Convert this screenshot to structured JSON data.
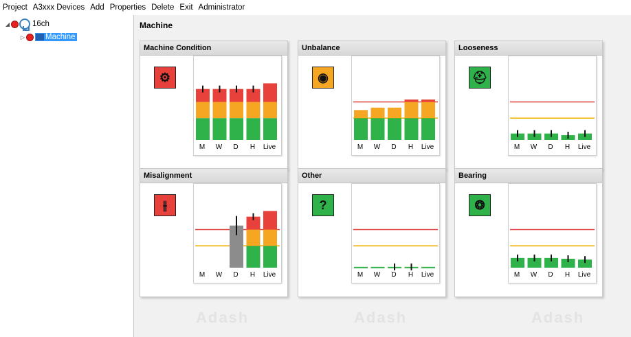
{
  "menu": [
    "Project",
    "A3xxx Devices",
    "Add",
    "Properties",
    "Delete",
    "Exit",
    "Administrator"
  ],
  "tree": {
    "root_label": "16ch",
    "child_label": "Machine"
  },
  "main": {
    "title": "Machine",
    "watermark": "Adash"
  },
  "colors": {
    "green": "#2fb24a",
    "orange": "#f5a623",
    "red": "#e8403a",
    "grey": "#8c8c8c",
    "red_line": "#e03c3c",
    "orange_line": "#f0b000"
  },
  "cards": [
    {
      "title": "Machine Condition",
      "icon": "machine-icon",
      "icon_glyph": "⚙",
      "icon_bg": "#e8403a",
      "x_labels": [
        "M",
        "W",
        "D",
        "H",
        "Live"
      ],
      "bars": [
        {
          "level": 0.63,
          "color": "traffic",
          "error": true
        },
        {
          "level": 0.63,
          "color": "traffic",
          "error": true
        },
        {
          "level": 0.63,
          "color": "traffic",
          "error": true
        },
        {
          "level": 0.63,
          "color": "traffic",
          "error": true
        },
        {
          "level": 0.7,
          "color": "traffic",
          "error": false
        }
      ],
      "show_threshold_lines": false
    },
    {
      "title": "Unbalance",
      "icon": "unbalance-icon",
      "icon_glyph": "◉",
      "icon_bg": "#f5a623",
      "x_labels": [
        "M",
        "W",
        "D",
        "H",
        "Live"
      ],
      "bars": [
        {
          "level": 0.37,
          "color": "traffic",
          "error": false
        },
        {
          "level": 0.4,
          "color": "traffic",
          "error": false
        },
        {
          "level": 0.4,
          "color": "traffic",
          "error": false
        },
        {
          "level": 0.5,
          "color": "traffic",
          "error": false
        },
        {
          "level": 0.5,
          "color": "traffic",
          "error": false
        }
      ],
      "show_threshold_lines": true
    },
    {
      "title": "Looseness",
      "icon": "looseness-icon",
      "icon_glyph": "⛑",
      "icon_bg": "#2fb24a",
      "x_labels": [
        "M",
        "W",
        "D",
        "H",
        "Live"
      ],
      "bars": [
        {
          "level": 0.08,
          "color": "traffic",
          "error": true
        },
        {
          "level": 0.08,
          "color": "traffic",
          "error": true
        },
        {
          "level": 0.08,
          "color": "traffic",
          "error": true
        },
        {
          "level": 0.06,
          "color": "traffic",
          "error": true
        },
        {
          "level": 0.08,
          "color": "traffic",
          "error": true
        }
      ],
      "show_threshold_lines": true
    },
    {
      "title": "Misalignment",
      "icon": "misalignment-icon",
      "icon_glyph": "⫲",
      "icon_bg": "#e8403a",
      "x_labels": [
        "M",
        "W",
        "D",
        "H",
        "Live"
      ],
      "bars": [
        {
          "level": 0.0,
          "color": "traffic",
          "error": false
        },
        {
          "level": 0.0,
          "color": "traffic",
          "error": false
        },
        {
          "level": 0.52,
          "color": "grey",
          "error": true
        },
        {
          "level": 0.63,
          "color": "traffic",
          "error": true
        },
        {
          "level": 0.7,
          "color": "traffic",
          "error": false
        }
      ],
      "show_threshold_lines": true
    },
    {
      "title": "Other",
      "icon": "question-icon",
      "icon_glyph": "?",
      "icon_bg": "#2fb24a",
      "x_labels": [
        "M",
        "W",
        "D",
        "H",
        "Live"
      ],
      "bars": [
        {
          "level": 0.01,
          "color": "traffic",
          "error": false
        },
        {
          "level": 0.01,
          "color": "traffic",
          "error": false
        },
        {
          "level": 0.01,
          "color": "traffic",
          "error": true
        },
        {
          "level": 0.01,
          "color": "traffic",
          "error": true
        },
        {
          "level": 0.01,
          "color": "traffic",
          "error": false
        }
      ],
      "show_threshold_lines": true
    },
    {
      "title": "Bearing",
      "icon": "bearing-icon",
      "icon_glyph": "❂",
      "icon_bg": "#2fb24a",
      "x_labels": [
        "M",
        "W",
        "D",
        "H",
        "Live"
      ],
      "bars": [
        {
          "level": 0.12,
          "color": "traffic",
          "error": true
        },
        {
          "level": 0.12,
          "color": "traffic",
          "error": true
        },
        {
          "level": 0.12,
          "color": "traffic",
          "error": true
        },
        {
          "level": 0.11,
          "color": "traffic",
          "error": true
        },
        {
          "level": 0.1,
          "color": "traffic",
          "error": true
        }
      ],
      "show_threshold_lines": true
    }
  ]
}
